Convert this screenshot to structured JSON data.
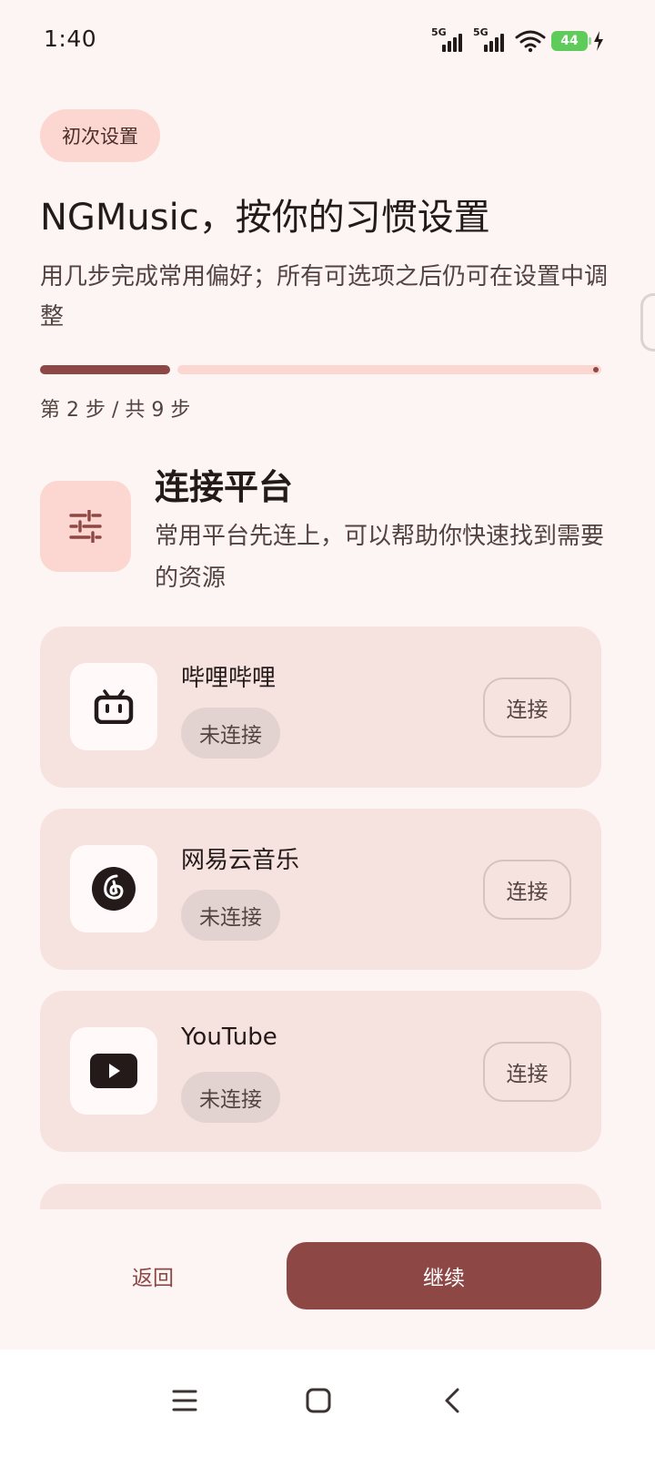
{
  "status_bar": {
    "time": "1:40",
    "network_1": "5G",
    "network_2": "5G",
    "battery": "44"
  },
  "header": {
    "chip": "初次设置",
    "title": "NGMusic，按你的习惯设置",
    "subtitle": "用几步完成常用偏好；所有可选项之后仍可在设置中调整"
  },
  "progress": {
    "step_label": "第 2 步 / 共 9 步",
    "current_step": 2,
    "total_steps": 9
  },
  "section": {
    "icon": "tune-sliders-icon",
    "title": "连接平台",
    "description": "常用平台先连上，可以帮助你快速找到需要的资源"
  },
  "platforms": [
    {
      "name": "哔哩哔哩",
      "status": "未连接",
      "action": "连接",
      "icon": "bilibili-icon"
    },
    {
      "name": "网易云音乐",
      "status": "未连接",
      "action": "连接",
      "icon": "netease-music-icon"
    },
    {
      "name": "YouTube",
      "status": "未连接",
      "action": "连接",
      "icon": "youtube-icon"
    }
  ],
  "actions": {
    "back": "返回",
    "continue": "继续"
  },
  "colors": {
    "primary": "#8d4845",
    "primary_container": "#fcd6d0",
    "card": "#f6e2de",
    "background": "#fdf5f3"
  }
}
